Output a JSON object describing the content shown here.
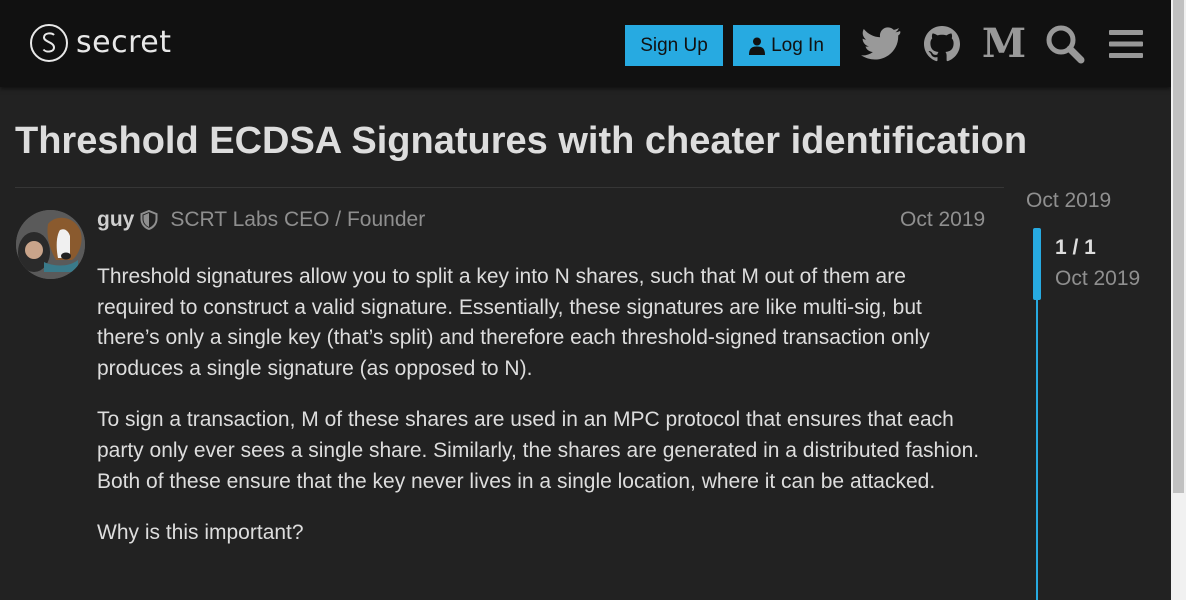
{
  "header": {
    "logo_text": "secret",
    "signup_label": "Sign Up",
    "login_label": "Log In",
    "icons": [
      "twitter-icon",
      "github-icon",
      "medium-icon",
      "search-icon",
      "menu-icon"
    ],
    "medium_glyph": "M"
  },
  "topic": {
    "title": "Threshold ECDSA Signatures with cheater identification"
  },
  "post": {
    "username": "guy",
    "user_title": "SCRT Labs CEO / Founder",
    "date": "Oct 2019",
    "paragraphs": [
      "Threshold signatures allow you to split a key into N shares, such that M out of them are required to construct a valid signature. Essentially, these signatures are like multi-sig, but there’s only a single key (that’s split) and therefore each threshold-signed transaction only produces a single signature (as opposed to N).",
      "To sign a transaction, M of these shares are used in an MPC protocol that ensures that each party only ever sees a single share. Similarly, the shares are generated in a distributed fashion. Both of these ensure that the key never lives in a single location, where it can be attacked.",
      "Why is this important?"
    ]
  },
  "timeline": {
    "top_date": "Oct 2019",
    "count": "1 / 1",
    "date": "Oct 2019"
  },
  "colors": {
    "accent": "#27aae1",
    "background": "#222222",
    "header": "#111111"
  }
}
